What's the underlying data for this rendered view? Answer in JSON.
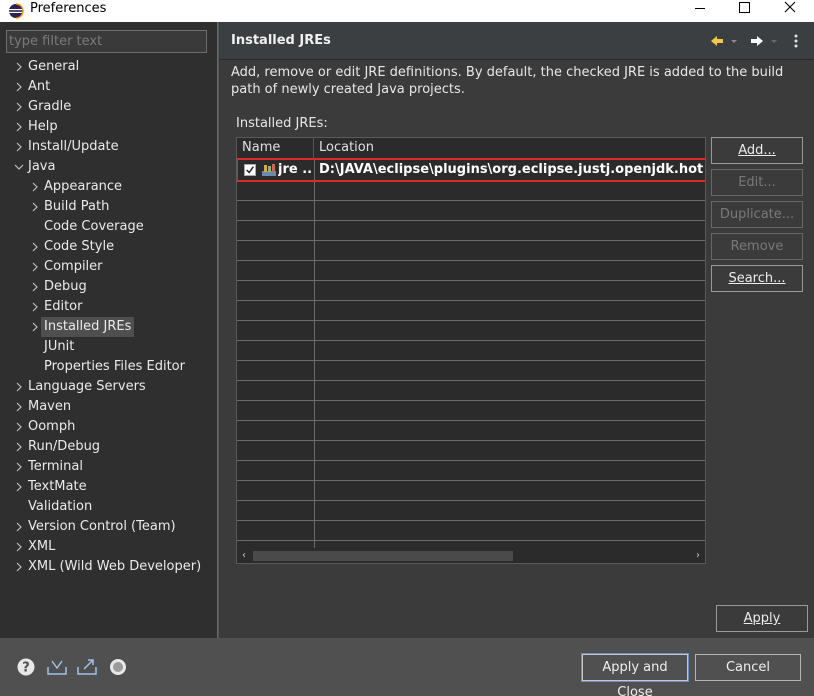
{
  "window": {
    "title": "Preferences",
    "minimize": "minimize",
    "maximize": "maximize",
    "close": "close"
  },
  "filter": {
    "placeholder": "type filter text"
  },
  "tree": {
    "items": [
      {
        "label": "General",
        "expandable": true
      },
      {
        "label": "Ant",
        "expandable": true
      },
      {
        "label": "Gradle",
        "expandable": true
      },
      {
        "label": "Help",
        "expandable": true
      },
      {
        "label": "Install/Update",
        "expandable": true
      },
      {
        "label": "Java",
        "expandable": true,
        "expanded": true
      },
      {
        "label": "Appearance",
        "expandable": true
      },
      {
        "label": "Build Path",
        "expandable": true
      },
      {
        "label": "Code Coverage",
        "expandable": false
      },
      {
        "label": "Code Style",
        "expandable": true
      },
      {
        "label": "Compiler",
        "expandable": true
      },
      {
        "label": "Debug",
        "expandable": true
      },
      {
        "label": "Editor",
        "expandable": true
      },
      {
        "label": "Installed JREs",
        "expandable": true,
        "selected": true
      },
      {
        "label": "JUnit",
        "expandable": false
      },
      {
        "label": "Properties Files Editor",
        "expandable": false
      },
      {
        "label": "Language Servers",
        "expandable": true
      },
      {
        "label": "Maven",
        "expandable": true
      },
      {
        "label": "Oomph",
        "expandable": true
      },
      {
        "label": "Run/Debug",
        "expandable": true
      },
      {
        "label": "Terminal",
        "expandable": true
      },
      {
        "label": "TextMate",
        "expandable": true
      },
      {
        "label": "Validation",
        "expandable": false
      },
      {
        "label": "Version Control (Team)",
        "expandable": true
      },
      {
        "label": "XML",
        "expandable": true
      },
      {
        "label": "XML (Wild Web Developer)",
        "expandable": true
      }
    ]
  },
  "page": {
    "title": "Installed JREs",
    "description": "Add, remove or edit JRE definitions. By default, the checked JRE is added to the build path of newly created Java projects.",
    "jres_label": "Installed JREs:",
    "columns": {
      "name": "Name",
      "location": "Location"
    },
    "rows": [
      {
        "checked": true,
        "name": "jre ...",
        "location": "D:\\JAVA\\eclipse\\plugins\\org.eclipse.justj.openjdk.hotspot.jre.f"
      }
    ],
    "buttons": {
      "add": "Add...",
      "edit": "Edit...",
      "duplicate": "Duplicate...",
      "remove": "Remove",
      "search": "Search..."
    },
    "apply": "Apply"
  },
  "footer": {
    "apply_close": "Apply and Close",
    "cancel": "Cancel"
  },
  "colors": {
    "accent_highlight": "#e02828",
    "background": "#3b3b3b"
  }
}
